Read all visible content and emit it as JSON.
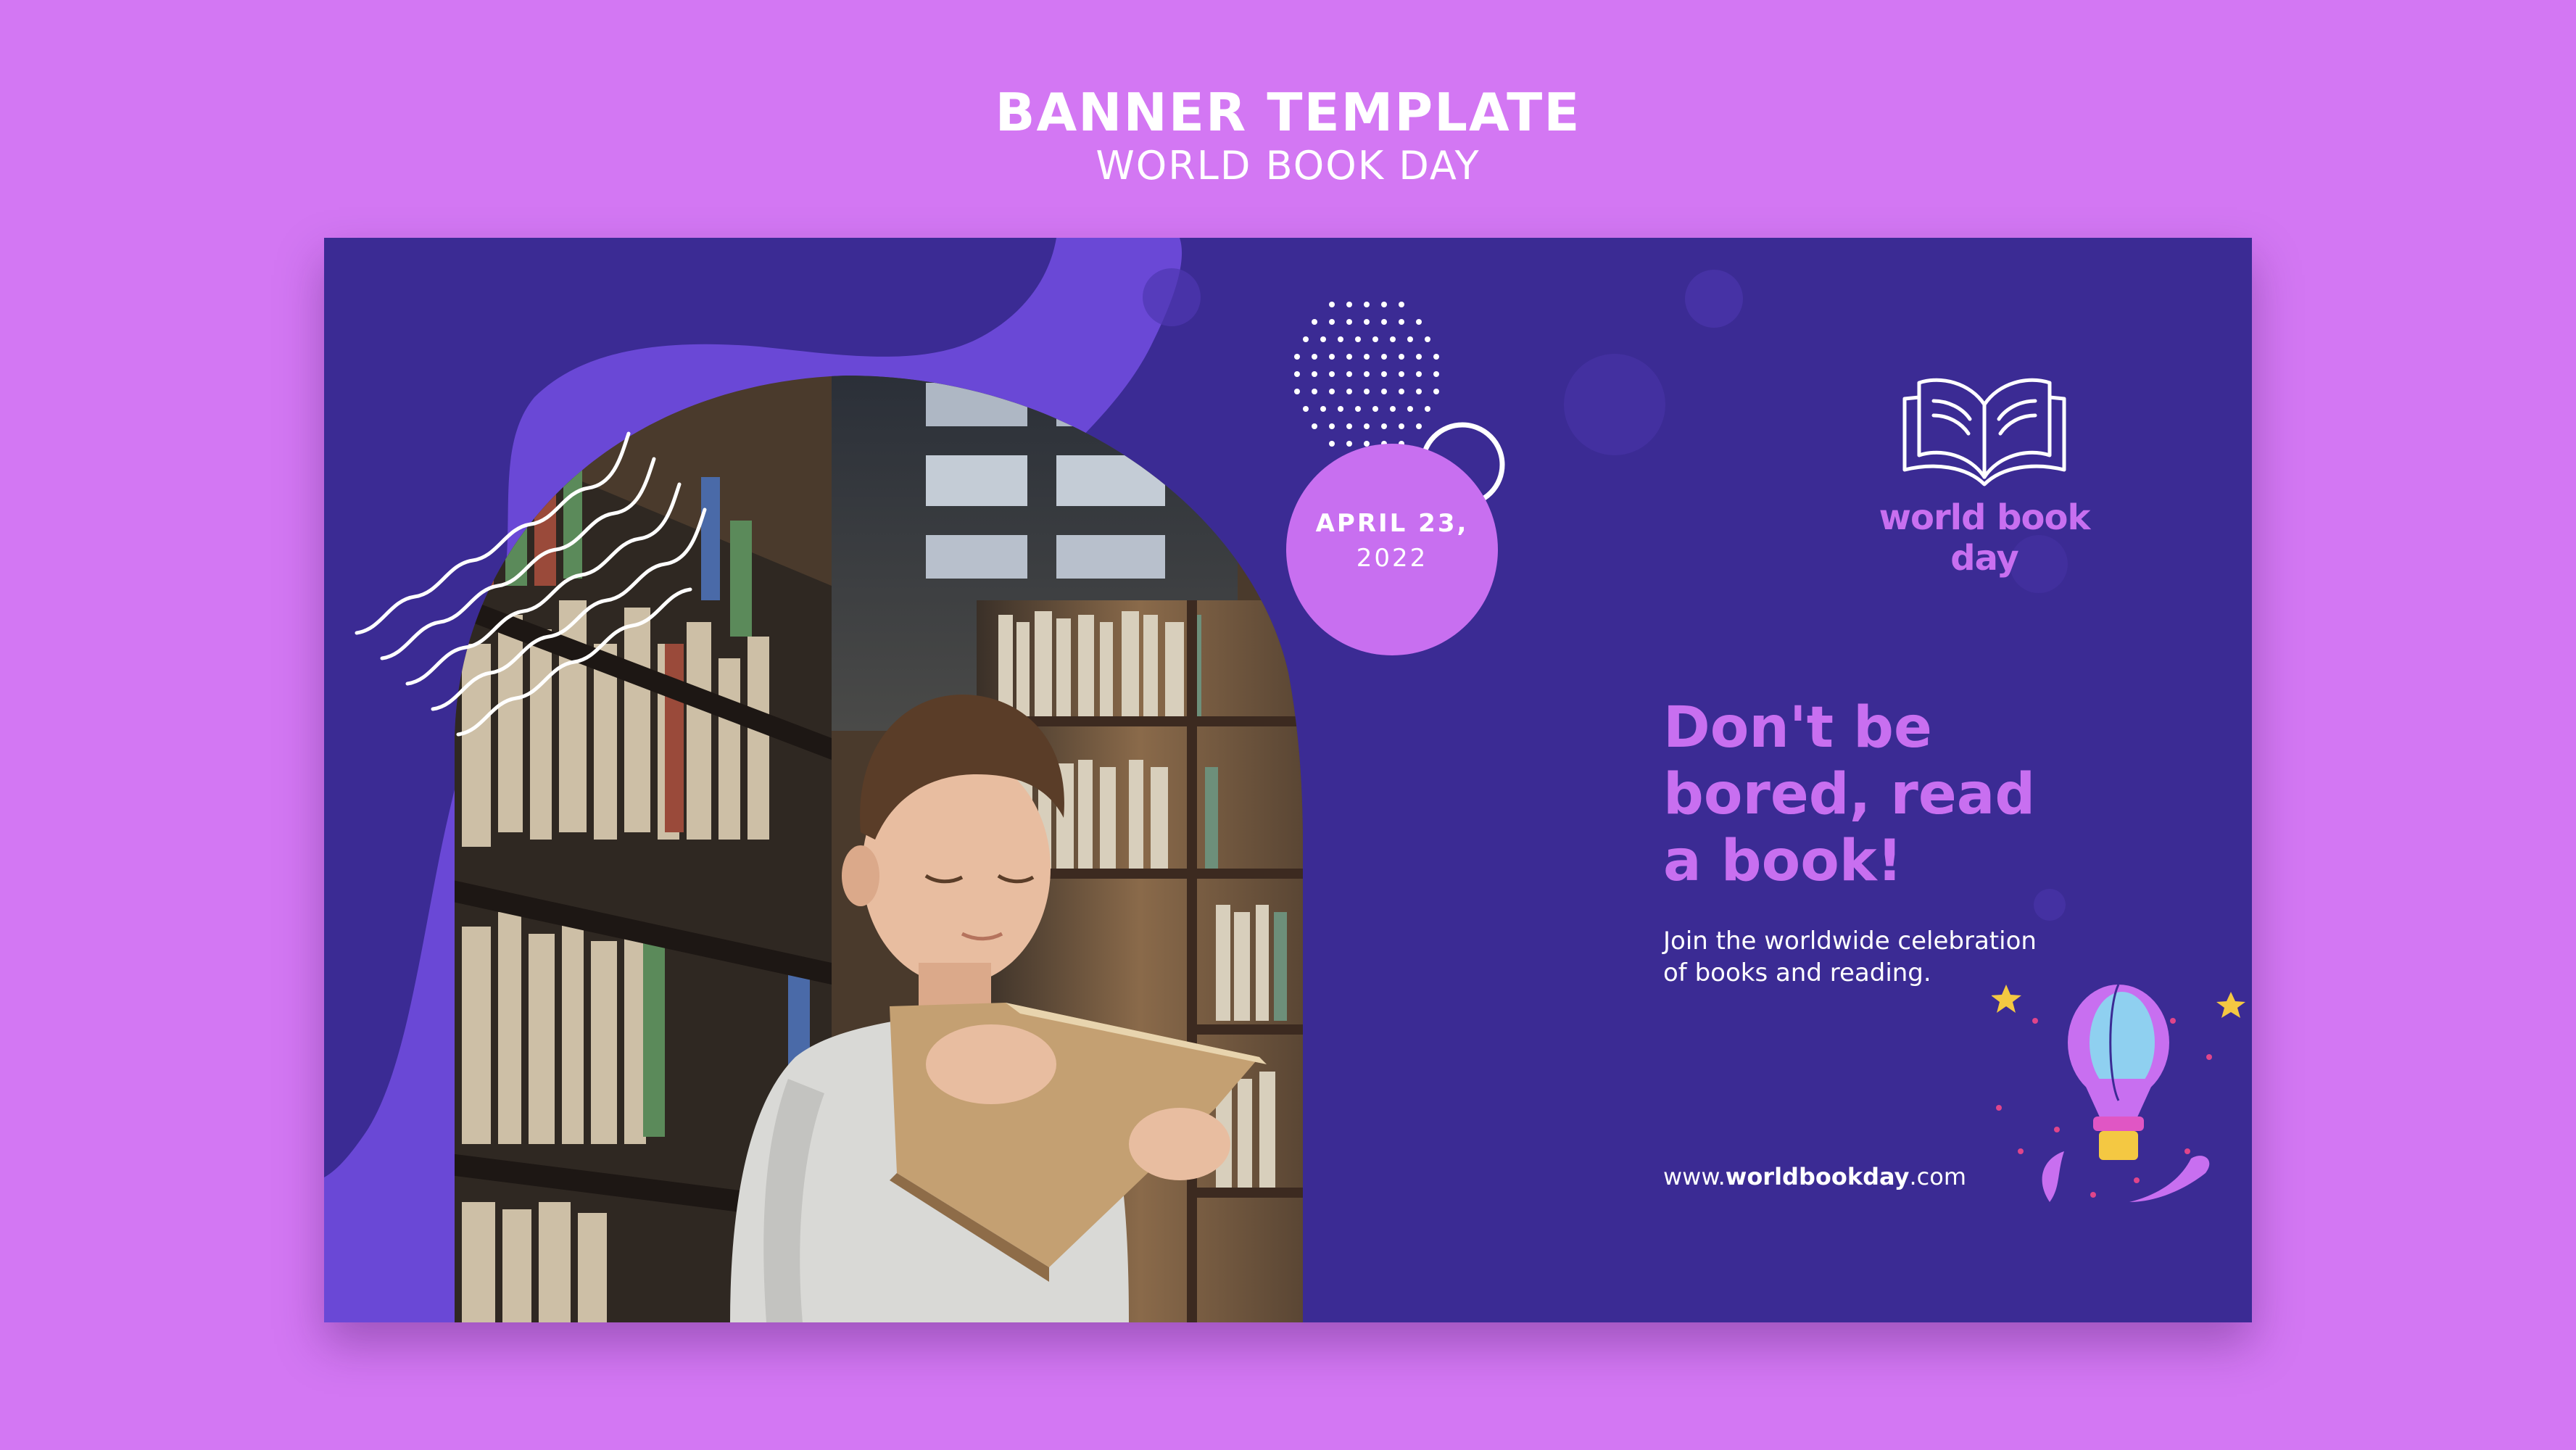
{
  "header": {
    "title": "BANNER TEMPLATE",
    "subtitle": "WORLD BOOK DAY"
  },
  "banner": {
    "date": {
      "line1": "APRIL 23,",
      "line2": "2022"
    },
    "logo": {
      "icon": "open-book-icon",
      "text": "world book day"
    },
    "headline": {
      "line1": "Don't be",
      "line2": "bored, read",
      "line3": "a book!"
    },
    "description": {
      "line1": "Join the worldwide celebration",
      "line2": "of books and reading."
    },
    "website": {
      "prefix": "www.",
      "domain": "worldbookday",
      "suffix": ".com"
    },
    "illustration": "hot-air-balloon-icon"
  },
  "colors": {
    "page_background": "#d377f3",
    "banner_background": "#3b2b94",
    "blob": "#6a48d6",
    "accent": "#c86ff0",
    "text": "#ffffff"
  }
}
